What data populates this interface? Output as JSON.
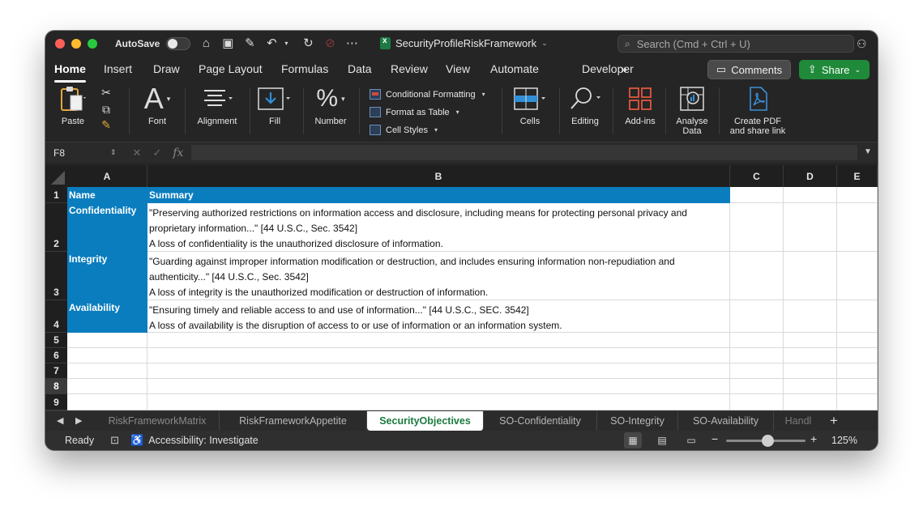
{
  "titlebar": {
    "autosave_label": "AutoSave",
    "document_title": "SecurityProfileRiskFramework",
    "search_placeholder": "Search (Cmd + Ctrl + U)"
  },
  "ribbon_tabs": [
    "Home",
    "Insert",
    "Draw",
    "Page Layout",
    "Formulas",
    "Data",
    "Review",
    "View",
    "Automate",
    "Developer"
  ],
  "ribbon_more": "»",
  "buttons": {
    "comments": "Comments",
    "share": "Share"
  },
  "ribbon": {
    "paste": "Paste",
    "font": "Font",
    "alignment": "Alignment",
    "fill": "Fill",
    "number": "Number",
    "conditional_formatting": "Conditional Formatting",
    "format_as_table": "Format as Table",
    "cell_styles": "Cell Styles",
    "cells": "Cells",
    "editing": "Editing",
    "addins": "Add-ins",
    "analyse_line1": "Analyse",
    "analyse_line2": "Data",
    "pdf_line1": "Create PDF",
    "pdf_line2": "and share link"
  },
  "formula_bar": {
    "name_box": "F8",
    "fx": "fx",
    "value": ""
  },
  "columns": [
    "A",
    "B",
    "C",
    "D",
    "E"
  ],
  "rows": [
    "1",
    "2",
    "3",
    "4",
    "5",
    "6",
    "7",
    "8",
    "9"
  ],
  "selected_row": "8",
  "sheet": {
    "header": {
      "name": "Name",
      "summary": "Summary"
    },
    "entries": [
      {
        "name": "Confidentiality",
        "line1": "\"Preserving authorized restrictions on information access and disclosure, including means for protecting personal privacy and",
        "line2": "proprietary information...\" [44 U.S.C., Sec. 3542]",
        "line3": "A loss of confidentiality is the unauthorized disclosure of information."
      },
      {
        "name": "Integrity",
        "line1": "\"Guarding against improper information modification or destruction, and includes ensuring information non-repudiation and",
        "line2": "authenticity...\" [44 U.S.C., Sec. 3542]",
        "line3": "A loss of integrity is the unauthorized modification or destruction of information."
      },
      {
        "name": "Availability",
        "line1": "\"Ensuring timely and reliable access to and use of information...\" [44 U.S.C., SEC. 3542]",
        "line2": "A loss of availability is the disruption of access to or use of information or an information system."
      }
    ]
  },
  "sheet_tabs": [
    "RiskFrameworkMatrix",
    "RiskFrameworkAppetite",
    "SecurityObjectives",
    "SO-Confidentiality",
    "SO-Integrity",
    "SO-Availability",
    "Handl"
  ],
  "active_sheet": "SecurityObjectives",
  "status": {
    "ready": "Ready",
    "accessibility": "Accessibility: Investigate",
    "zoom": "125%",
    "zoom_level_percent": 125
  },
  "colors": {
    "header_fill": "#0a7dbe",
    "share_green": "#1f8a3a",
    "active_tab_text": "#1c7a3f"
  }
}
